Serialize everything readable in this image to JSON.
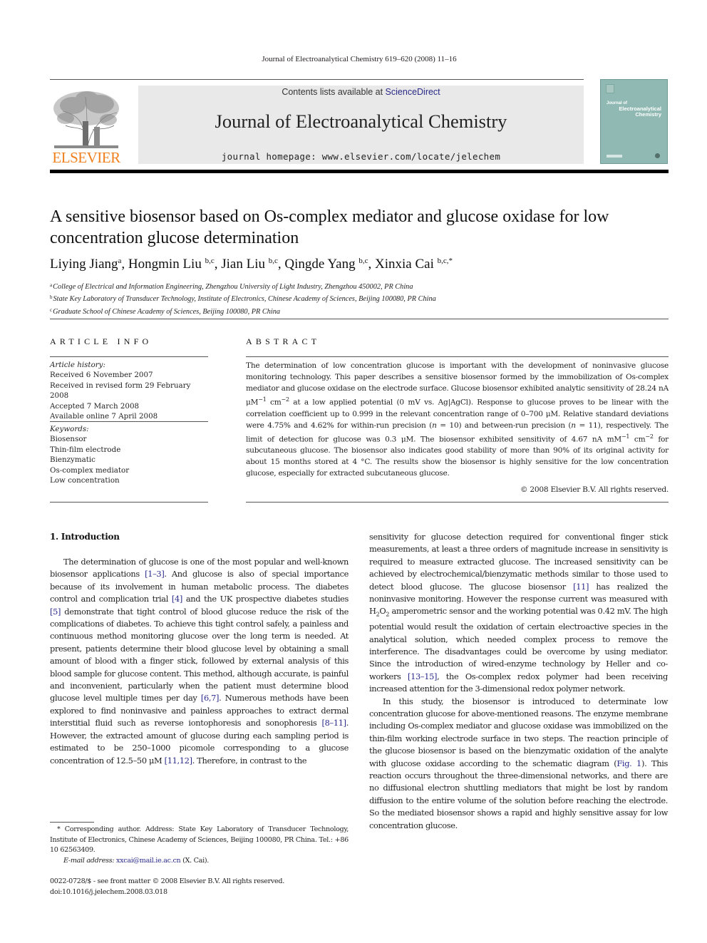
{
  "running_head": "Journal of Electroanalytical Chemistry 619–620 (2008) 11–16",
  "publisher": {
    "logo_word": "ELSEVIER",
    "brand_color": "#f07f1d"
  },
  "banner": {
    "contents_prefix": "Contents lists available at ",
    "contents_link": "ScienceDirect",
    "journal_title": "Journal of Electroanalytical Chemistry",
    "homepage": "journal homepage: www.elsevier.com/locate/jelechem"
  },
  "cover": {
    "line1": "Journal of",
    "line2": "Electroanalytical",
    "line3": "Chemistry"
  },
  "article": {
    "title": "A sensitive biosensor based on Os-complex mediator and glucose oxidase for low concentration glucose determination",
    "authors": [
      {
        "name": "Liying Jiang",
        "sup": "a",
        "sep": ", "
      },
      {
        "name": "Hongmin Liu",
        "sup": "b,c",
        "sep": ", "
      },
      {
        "name": "Jian Liu",
        "sup": "b,c",
        "sep": ", "
      },
      {
        "name": "Qingde Yang",
        "sup": "b,c",
        "sep": ", "
      },
      {
        "name": "Xinxia Cai",
        "sup": "b,c,*",
        "sep": ""
      }
    ],
    "affiliations": [
      {
        "key": "a",
        "text": "College of Electrical and Information Engineering, Zhengzhou University of Light Industry, Zhengzhou 450002, PR China"
      },
      {
        "key": "b",
        "text": "State Key Laboratory of Transducer Technology, Institute of Electronics, Chinese Academy of Sciences, Beijing 100080, PR China"
      },
      {
        "key": "c",
        "text": "Graduate School of Chinese Academy of Sciences, Beijing 100080, PR China"
      }
    ]
  },
  "article_info": {
    "heading": "ARTICLE INFO",
    "history_label": "Article history:",
    "history": [
      "Received 6 November 2007",
      "Received in revised form 29 February 2008",
      "Accepted 7 March 2008",
      "Available online 7 April 2008"
    ],
    "keywords_label": "Keywords:",
    "keywords": [
      "Biosensor",
      "Thin-film electrode",
      "Bienzymatic",
      "Os-complex mediator",
      "Low concentration"
    ]
  },
  "abstract": {
    "heading": "ABSTRACT",
    "p1": "The determination of low concentration glucose is important with the development of noninvasive glucose monitoring technology. This paper describes a sensitive biosensor formed by the immobilization of Os-complex mediator and glucose oxidase on the electrode surface. Glucose biosensor exhibited analytic sensitivity of 28.24 nA μM",
    "s1": "−1",
    "p2": " cm",
    "s2": "−2",
    "p3": " at a low applied potential (0 mV vs. Ag|AgCl). Response to glucose proves to be linear with the correlation coefficient up to 0.999 in the relevant concentration range of 0–700 μM. Relative standard deviations were 4.75% and 4.62% for within-run precision (",
    "n1": "n",
    "p4": " = 10) and between-run precision (",
    "n2": "n",
    "p5": " = 11), respectively. The limit of detection for glucose was 0.3 μM. The biosensor exhibited sensitivity of 4.67 nA mM",
    "s3": "−1",
    "p6": " cm",
    "s4": "−2",
    "p7": " for subcutaneous glucose. The biosensor also indicates good stability of more than 90% of its original activity for about 15 months stored at 4 °C. The results show the biosensor is highly sensitive for the low concentration glucose, especially for extracted subcutaneous glucose.",
    "copyright": "© 2008 Elsevier B.V. All rights reserved."
  },
  "body": {
    "section_heading": "1. Introduction",
    "left_p1": [
      {
        "t": "The determination of glucose is one of the most popular and well-known biosensor applications "
      },
      {
        "r": "[1–3]"
      },
      {
        "t": ". And glucose is also of special importance because of its involvement in human metabolic process. The diabetes control and complication trial "
      },
      {
        "r": "[4]"
      },
      {
        "t": " and the UK prospective diabetes studies "
      },
      {
        "r": "[5]"
      },
      {
        "t": " demonstrate that tight control of blood glucose reduce the risk of the complications of diabetes. To achieve this tight control safely, a painless and continuous method monitoring glucose over the long term is needed. At present, patients determine their blood glucose level by obtaining a small amount of blood with a finger stick, followed by external analysis of this blood sample for glucose content. This method, although accurate, is painful and inconvenient, particularly when the patient must determine blood glucose level multiple times per day "
      },
      {
        "r": "[6,7]"
      },
      {
        "t": ". Numerous methods have been explored to find noninvasive and painless approaches to extract dermal interstitial fluid such as reverse iontophoresis and sonophoresis "
      },
      {
        "r": "[8–11]"
      },
      {
        "t": ". However, the extracted amount of glucose during each sampling period is estimated to be 250–1000 picomole corresponding to a glucose concentration of 12.5–50 μM "
      },
      {
        "r": "[11,12]"
      },
      {
        "t": ". Therefore, in contrast to the"
      }
    ],
    "right_p1": [
      {
        "t": "sensitivity for glucose detection required for conventional finger stick measurements, at least a three orders of magnitude increase in sensitivity is required to measure extracted glucose. The increased sensitivity can be achieved by electrochemical/bienzymatic methods similar to those used to detect blood glucose. The glucose biosensor "
      },
      {
        "r": "[11]"
      },
      {
        "t": " has realized the noninvasive monitoring. However the response current was measured with H"
      },
      {
        "sub": "2"
      },
      {
        "t": "O"
      },
      {
        "sub": "2"
      },
      {
        "t": " amperometric sensor and the working potential was 0.42 mV. The high potential would result the oxidation of certain electroactive species in the analytical solution, which needed complex process to remove the interference. The disadvantages could be overcome by using mediator. Since the introduction of wired-enzyme technology by Heller and co-workers "
      },
      {
        "r": "[13–15]"
      },
      {
        "t": ", the Os-complex redox polymer had been receiving increased attention for the 3-dimensional redox polymer network."
      }
    ],
    "right_p2": [
      {
        "t": "In this study, the biosensor is introduced to determinate low concentration glucose for above-mentioned reasons. The enzyme membrane including Os-complex mediator and glucose oxidase was immobilized on the thin-film working electrode surface in two steps. The reaction principle of the glucose biosensor is based on the bienzymatic oxidation of the analyte with glucose oxidase according to the schematic diagram ("
      },
      {
        "r": "Fig. 1"
      },
      {
        "t": "). This reaction occurs throughout the three-dimensional networks, and there are no diffusional electron shuttling mediators that might be lost by random diffusion to the entire volume of the solution before reaching the electrode. So the mediated biosensor shows a rapid and highly sensitive assay for low concentration glucose."
      }
    ]
  },
  "footnote": {
    "marker": "*",
    "text": " Corresponding author. Address: State Key Laboratory of Transducer Technology, Institute of Electronics, Chinese Academy of Sciences, Beijing 100080, PR China. Tel.: +86 10 62563409.",
    "email_label": "E-mail address:",
    "email": "xxcai@mail.ie.ac.cn",
    "email_suffix": " (X. Cai)."
  },
  "issn": {
    "line1": "0022-0728/$ - see front matter © 2008 Elsevier B.V. All rights reserved.",
    "doi": "doi:10.1016/j.jelechem.2008.03.018"
  },
  "colors": {
    "link": "#2b2b8c",
    "banner_bg": "#e9e9e9",
    "cover_bg": "#8fb9b2"
  }
}
